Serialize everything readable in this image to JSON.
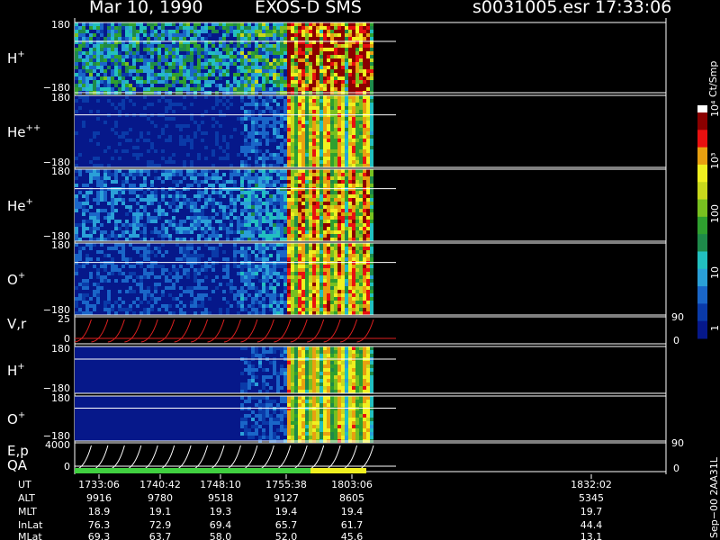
{
  "header": {
    "date": "Mar 10, 1990",
    "instrument": "EXOS-D SMS",
    "file_id": "s0031005.esr",
    "time": "17:33:06"
  },
  "chart_data": {
    "type": "heatmap",
    "panels": [
      {
        "label": "H",
        "sup": "+",
        "ymax": "180",
        "ymin": "−180",
        "intensity": 0.55
      },
      {
        "label": "He",
        "sup": "++",
        "ymax": "180",
        "ymin": "−180",
        "intensity": 0.15
      },
      {
        "label": "He",
        "sup": "+",
        "ymax": "180",
        "ymin": "−180",
        "intensity": 0.3
      },
      {
        "label": "O",
        "sup": "+",
        "ymax": "180",
        "ymin": "−180",
        "intensity": 0.22
      },
      {
        "label": "V,r",
        "sup": "",
        "ymax": "25",
        "ymin": "0",
        "rmax": "90",
        "rmin": "0"
      },
      {
        "label": "H",
        "sup": "+",
        "ymax": "180",
        "ymin": "−180",
        "intensity": 0.12
      },
      {
        "label": "O",
        "sup": "+",
        "ymax": "180",
        "ymin": "−180",
        "intensity": 0.12
      },
      {
        "label": "E,p",
        "label2": "QA",
        "sup": "",
        "ymax": "4000",
        "ymin": "0",
        "rmax": "90",
        "rmin": "0"
      }
    ],
    "colorbar": {
      "title": "Ct/Smp",
      "ticks": [
        "1",
        "10",
        "100",
        "10³",
        "10⁴"
      ]
    },
    "orbit": {
      "row_labels": [
        "UT",
        "ALT",
        "MLT",
        "InLat",
        "MLat"
      ],
      "columns": [
        {
          "UT": "1733:06",
          "ALT": "9916",
          "MLT": "18.9",
          "InLat": "76.3",
          "MLat": "69.3"
        },
        {
          "UT": "1740:42",
          "ALT": "9780",
          "MLT": "19.1",
          "InLat": "72.9",
          "MLat": "63.7"
        },
        {
          "UT": "1748:10",
          "ALT": "9518",
          "MLT": "19.3",
          "InLat": "69.4",
          "MLat": "58.0"
        },
        {
          "UT": "1755:38",
          "ALT": "9127",
          "MLT": "19.4",
          "InLat": "65.7",
          "MLat": "52.0"
        },
        {
          "UT": "1803:06",
          "ALT": "8605",
          "MLT": "19.4",
          "InLat": "61.7",
          "MLat": "45.6"
        },
        {
          "UT": "1832:02",
          "ALT": "5345",
          "MLT": "19.7",
          "InLat": "44.4",
          "MLat": "13.1"
        }
      ]
    },
    "footer_tag": "Sep−00 2AA31L"
  }
}
